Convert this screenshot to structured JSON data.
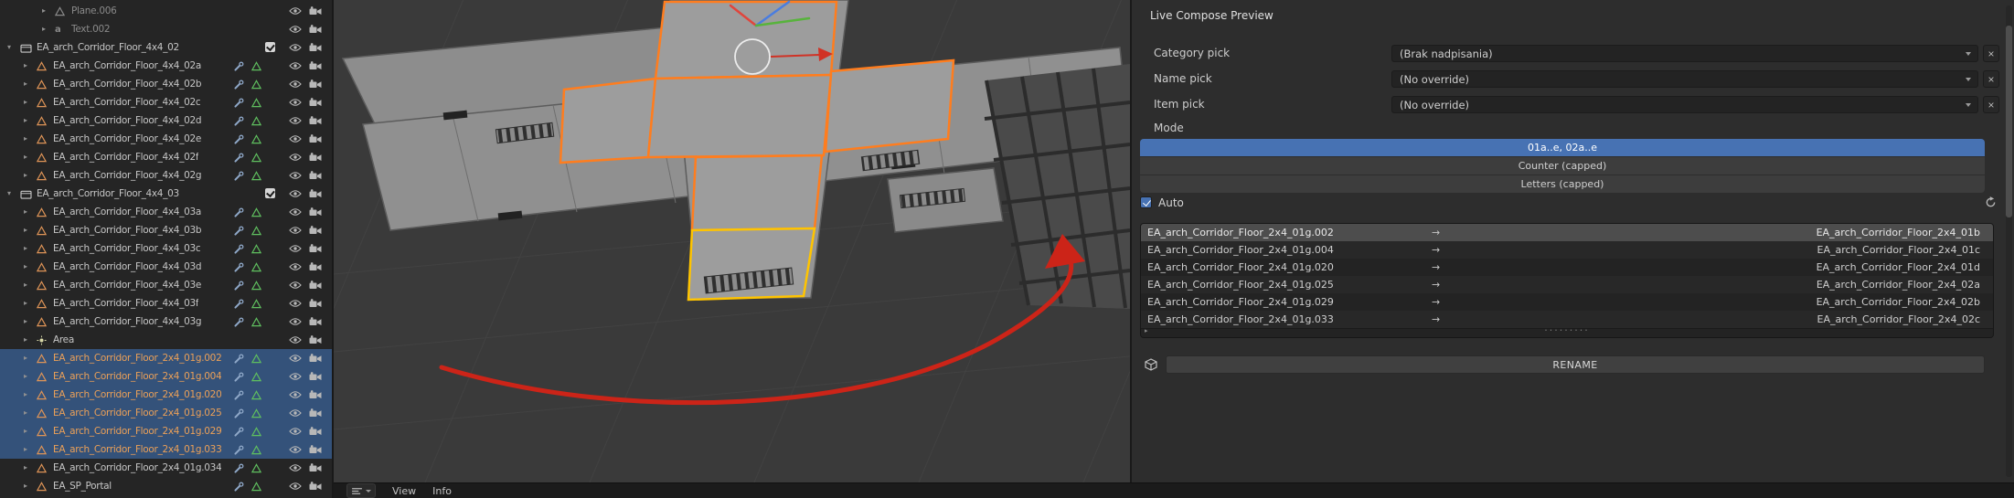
{
  "colors": {
    "accent_blue": "#4772b3",
    "selection_blue": "#34527a",
    "selected_text_orange": "#eba058",
    "annotation_red": "#cc2418",
    "selection_outline_orange": "#ff7d1e",
    "active_outline_yellow": "#ffc400"
  },
  "icons": {
    "clear": "×",
    "arrow_right": "→",
    "disclosure_collapsed": "▸",
    "disclosure_expanded": "▾"
  },
  "outliner": {
    "items": [
      {
        "label": "Plane.006",
        "type": "object",
        "grayed": true,
        "deep": true,
        "nomods": true
      },
      {
        "label": "Text.002",
        "type": "text",
        "grayed": true,
        "deep": true,
        "nomods": true
      },
      {
        "label": "EA_arch_Corridor_Floor_4x4_02",
        "type": "collection",
        "checked": true,
        "nomods": true
      },
      {
        "label": "EA_arch_Corridor_Floor_4x4_02a",
        "type": "object"
      },
      {
        "label": "EA_arch_Corridor_Floor_4x4_02b",
        "type": "object"
      },
      {
        "label": "EA_arch_Corridor_Floor_4x4_02c",
        "type": "object"
      },
      {
        "label": "EA_arch_Corridor_Floor_4x4_02d",
        "type": "object"
      },
      {
        "label": "EA_arch_Corridor_Floor_4x4_02e",
        "type": "object"
      },
      {
        "label": "EA_arch_Corridor_Floor_4x4_02f",
        "type": "object"
      },
      {
        "label": "EA_arch_Corridor_Floor_4x4_02g",
        "type": "object"
      },
      {
        "label": "EA_arch_Corridor_Floor_4x4_03",
        "type": "collection",
        "checked": true,
        "nomods": true
      },
      {
        "label": "EA_arch_Corridor_Floor_4x4_03a",
        "type": "object"
      },
      {
        "label": "EA_arch_Corridor_Floor_4x4_03b",
        "type": "object"
      },
      {
        "label": "EA_arch_Corridor_Floor_4x4_03c",
        "type": "object"
      },
      {
        "label": "EA_arch_Corridor_Floor_4x4_03d",
        "type": "object"
      },
      {
        "label": "EA_arch_Corridor_Floor_4x4_03e",
        "type": "object"
      },
      {
        "label": "EA_arch_Corridor_Floor_4x4_03f",
        "type": "object"
      },
      {
        "label": "EA_arch_Corridor_Floor_4x4_03g",
        "type": "object"
      },
      {
        "label": "Area",
        "type": "light",
        "nomods": true
      },
      {
        "label": "EA_arch_Corridor_Floor_2x4_01g.002",
        "type": "object",
        "selected": true
      },
      {
        "label": "EA_arch_Corridor_Floor_2x4_01g.004",
        "type": "object",
        "selected": true
      },
      {
        "label": "EA_arch_Corridor_Floor_2x4_01g.020",
        "type": "object",
        "selected": true
      },
      {
        "label": "EA_arch_Corridor_Floor_2x4_01g.025",
        "type": "object",
        "selected": true
      },
      {
        "label": "EA_arch_Corridor_Floor_2x4_01g.029",
        "type": "object",
        "selected": true
      },
      {
        "label": "EA_arch_Corridor_Floor_2x4_01g.033",
        "type": "object",
        "selected": true
      },
      {
        "label": "EA_arch_Corridor_Floor_2x4_01g.034",
        "type": "object"
      },
      {
        "label": "EA_SP_Portal",
        "type": "object"
      }
    ]
  },
  "footer": {
    "view": "View",
    "info": "Info"
  },
  "panel": {
    "title": "Live Compose Preview",
    "pickers": [
      {
        "label": "Category pick",
        "value": "(Brak nadpisania)"
      },
      {
        "label": "Name pick",
        "value": "(No override)"
      },
      {
        "label": "Item pick",
        "value": "(No override)"
      }
    ],
    "mode_label": "Mode",
    "modes": [
      {
        "label": "01a..e, 02a..e",
        "active": true
      },
      {
        "label": "Counter (capped)"
      },
      {
        "label": "Letters (capped)"
      }
    ],
    "auto_label": "Auto",
    "renames": [
      {
        "from": "EA_arch_Corridor_Floor_2x4_01g.002",
        "to": "EA_arch_Corridor_Floor_2x4_01b",
        "selected": true
      },
      {
        "from": "EA_arch_Corridor_Floor_2x4_01g.004",
        "to": "EA_arch_Corridor_Floor_2x4_01c"
      },
      {
        "from": "EA_arch_Corridor_Floor_2x4_01g.020",
        "to": "EA_arch_Corridor_Floor_2x4_01d"
      },
      {
        "from": "EA_arch_Corridor_Floor_2x4_01g.025",
        "to": "EA_arch_Corridor_Floor_2x4_02a"
      },
      {
        "from": "EA_arch_Corridor_Floor_2x4_01g.029",
        "to": "EA_arch_Corridor_Floor_2x4_02b"
      },
      {
        "from": "EA_arch_Corridor_Floor_2x4_01g.033",
        "to": "EA_arch_Corridor_Floor_2x4_02c"
      }
    ],
    "rename_button": "RENAME"
  }
}
